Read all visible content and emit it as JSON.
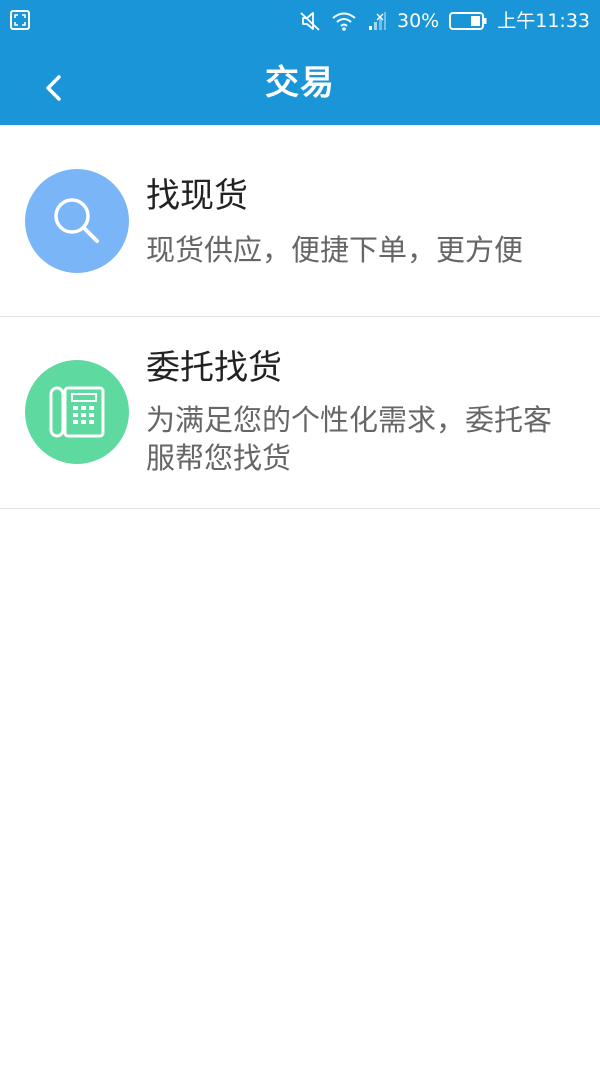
{
  "status_bar": {
    "battery_percent": "30%",
    "time": "上午11:33",
    "icons": [
      "screenshot-icon",
      "mute-icon",
      "wifi-icon",
      "signal-icon",
      "battery-icon"
    ]
  },
  "header": {
    "title": "交易",
    "back_icon": "back-arrow-icon",
    "background_color": "#1a96d8"
  },
  "items": [
    {
      "title": "找现货",
      "description": "现货供应，便捷下单，更方便",
      "icon": "search-icon",
      "icon_color": "#7ab6f7"
    },
    {
      "title": "委托找货",
      "description": "为满足您的个性化需求，委托客服帮您找货",
      "icon": "telephone-icon",
      "icon_color": "#5ed9a0"
    }
  ]
}
